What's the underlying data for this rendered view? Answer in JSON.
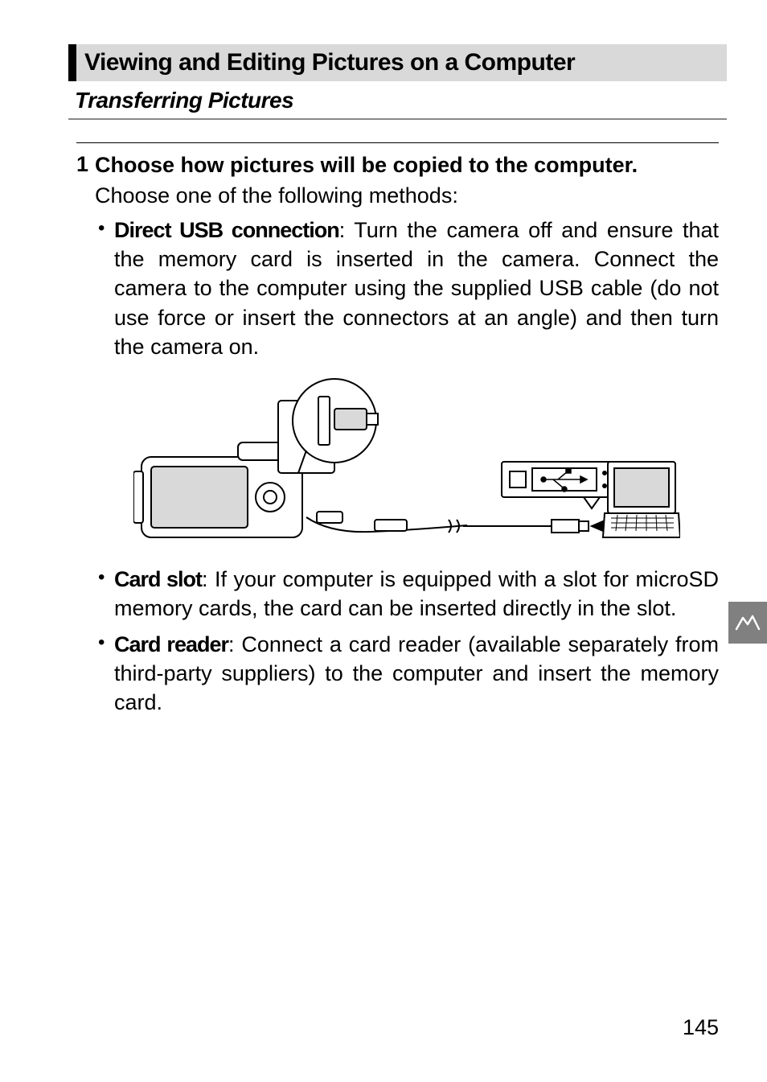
{
  "section_header": "Viewing and Editing Pictures on a Computer",
  "subsection": "Transferring Pictures",
  "step": {
    "number": "1",
    "title": "Choose how pictures will be copied to the computer.",
    "intro": "Choose one of the following methods:",
    "bullets": [
      {
        "label": "Direct USB connection",
        "text": ": Turn the camera off and ensure that the memory card is inserted in the camera. Connect the camera to the computer using the supplied USB cable (do not use force or insert the connectors at an angle) and then turn the camera on."
      },
      {
        "label": "Card slot",
        "text": ": If your computer is equipped with a slot for microSD memory cards, the card can be inserted directly in the slot."
      },
      {
        "label": "Card reader",
        "text": ": Connect a card reader (available separately from third-party suppliers) to the computer and insert the memory card."
      }
    ]
  },
  "page_number": "145"
}
